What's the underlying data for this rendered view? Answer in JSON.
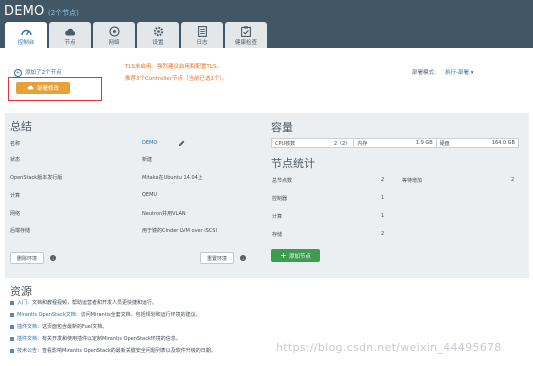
{
  "env": {
    "title": "DEMO",
    "nodes_badge": "(2个节点)"
  },
  "tabs": [
    {
      "label": "控制台",
      "icon": "dashboard-icon"
    },
    {
      "label": "节点",
      "icon": "cloud-icon"
    },
    {
      "label": "网络",
      "icon": "network-icon"
    },
    {
      "label": "设置",
      "icon": "gear-icon"
    },
    {
      "label": "日志",
      "icon": "log-icon"
    },
    {
      "label": "健康检查",
      "icon": "health-check-icon"
    }
  ],
  "deploy": {
    "added_text": "添加了2个节点",
    "deploy_button": "部署修改",
    "warning_line1": "TLS未启用。强烈建议启用和配置TLS。",
    "warning_line2": "推荐3个Controller节点（当前已选1个）。",
    "mode_label": "部署模式:",
    "mode_value": "执行-部署"
  },
  "summary": {
    "title": "总结",
    "rows": [
      {
        "key": "名称",
        "value": "DEMO"
      },
      {
        "key": "状态",
        "value": "新建"
      },
      {
        "key": "OpenStack版本发行版",
        "value": "Mitaka在Ubuntu 14.04上"
      },
      {
        "key": "计算",
        "value": "QEMU"
      },
      {
        "key": "网络",
        "value": "Neutron并用VLAN"
      },
      {
        "key": "后端存储",
        "value": "用于镜的Cinder LVM over iSCSI"
      }
    ],
    "delete_button": "删除环境",
    "reset_button": "重置环境"
  },
  "capacity": {
    "title": "容量",
    "cells": [
      {
        "label": "CPU核数",
        "value": "2（2）"
      },
      {
        "label": "内存",
        "value": "1.9 GB"
      },
      {
        "label": "硬盘",
        "value": "164.0 GB"
      }
    ]
  },
  "node_stats": {
    "title": "节点统计",
    "rows": [
      {
        "label": "总节点数",
        "value": "2"
      },
      {
        "label": "控制器",
        "value": "1"
      },
      {
        "label": "计算",
        "value": "1"
      },
      {
        "label": "存储",
        "value": "2"
      }
    ],
    "pending_label": "等待增加",
    "pending_value": "2",
    "add_button": "添加节点"
  },
  "resources": {
    "title": "资源",
    "items": [
      {
        "link": "入门：",
        "text": "文档和教程视频，帮助运营者和开发人员更快捷和运行。"
      },
      {
        "link": "Mirantis OpenStack文档：",
        "text": "访问Mirantis全套文档，包括规划和运行环境的建议。"
      },
      {
        "link": "插件文档：",
        "text": "这页面包含最新的Fuel文档。"
      },
      {
        "link": "插件文档：",
        "text": "有关开发和使用插件以定制Mirantis OpenStack环境的信息。"
      },
      {
        "link": "技术公告：",
        "text": "查看影响Mirantis OpenStack的最新关键安全问题列表以及软件升级的日期。"
      }
    ]
  },
  "watermark": "https://blog.csdn.net/weixin_44495678",
  "colors": {
    "header": "#415766",
    "accent": "#2a6fa8",
    "warning": "#e27424",
    "deploy_button": "#e6a23a",
    "add_button": "#3e9b52",
    "highlight_box": "#e0343a"
  }
}
